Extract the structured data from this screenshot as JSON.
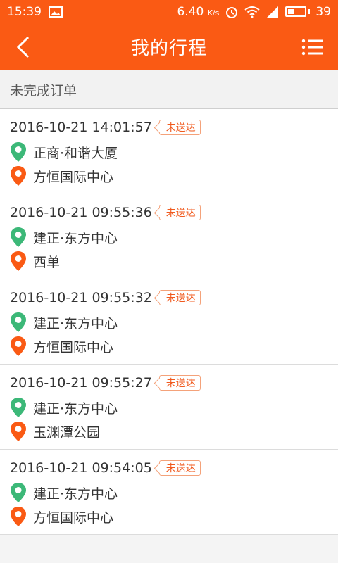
{
  "status_bar": {
    "time": "15:39",
    "speed": "6.40",
    "speed_unit": "K/s",
    "battery": "39"
  },
  "header": {
    "title": "我的行程"
  },
  "section": {
    "title": "未完成订单"
  },
  "colors": {
    "accent": "#fa5a14",
    "start_pin": "#3cb878",
    "end_pin": "#fa5a14",
    "badge": "#f05a1e"
  },
  "orders": [
    {
      "datetime": "2016-10-21 14:01:57",
      "status": "未送达",
      "from": "正商·和谐大厦",
      "to": "方恒国际中心"
    },
    {
      "datetime": "2016-10-21 09:55:36",
      "status": "未送达",
      "from": "建正·东方中心",
      "to": "西单"
    },
    {
      "datetime": "2016-10-21 09:55:32",
      "status": "未送达",
      "from": "建正·东方中心",
      "to": "方恒国际中心"
    },
    {
      "datetime": "2016-10-21 09:55:27",
      "status": "未送达",
      "from": "建正·东方中心",
      "to": "玉渊潭公园"
    },
    {
      "datetime": "2016-10-21 09:54:05",
      "status": "未送达",
      "from": "建正·东方中心",
      "to": "方恒国际中心"
    }
  ]
}
